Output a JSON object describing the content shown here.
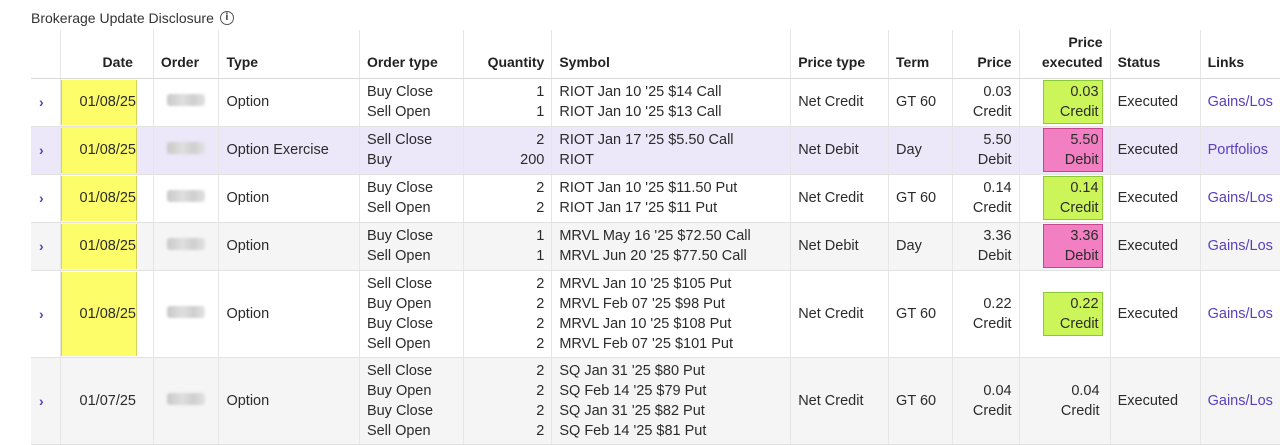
{
  "section": {
    "title": "Brokerage Update Disclosure"
  },
  "headers": {
    "date": "Date",
    "order": "Order",
    "type": "Type",
    "order_type": "Order type",
    "quantity": "Quantity",
    "symbol": "Symbol",
    "price_type": "Price type",
    "term": "Term",
    "price": "Price",
    "price_executed_l1": "Price",
    "price_executed_l2": "executed",
    "status": "Status",
    "links": "Links"
  },
  "colors": {
    "credit_highlight": "#ccf55a",
    "debit_highlight": "#f27fc1",
    "date_highlight": "#fdfd6a",
    "link": "#5a3fc0"
  },
  "rows": [
    {
      "date": "01/08/25",
      "type": "Option",
      "legs": [
        {
          "order_type": "Buy Close",
          "qty": "1",
          "symbol": "RIOT Jan 10 '25 $14 Call"
        },
        {
          "order_type": "Sell Open",
          "qty": "1",
          "symbol": "RIOT Jan 10 '25 $13 Call"
        }
      ],
      "price_type": "Net Credit",
      "term": "GT 60",
      "price": "0.03",
      "price_side": "Credit",
      "executed": "0.03",
      "executed_side": "Credit",
      "status": "Executed",
      "link": "Gains/Los"
    },
    {
      "date": "01/08/25",
      "type": "Option Exercise",
      "legs": [
        {
          "order_type": "Sell Close",
          "qty": "2",
          "symbol": "RIOT Jan 17 '25 $5.50 Call"
        },
        {
          "order_type": "Buy",
          "qty": "200",
          "symbol": "RIOT"
        }
      ],
      "price_type": "Net Debit",
      "term": "Day",
      "price": "5.50",
      "price_side": "Debit",
      "executed": "5.50",
      "executed_side": "Debit",
      "status": "Executed",
      "link": "Portfolios"
    },
    {
      "date": "01/08/25",
      "type": "Option",
      "legs": [
        {
          "order_type": "Buy Close",
          "qty": "2",
          "symbol": "RIOT Jan 10 '25 $11.50 Put"
        },
        {
          "order_type": "Sell Open",
          "qty": "2",
          "symbol": "RIOT Jan 17 '25 $11 Put"
        }
      ],
      "price_type": "Net Credit",
      "term": "GT 60",
      "price": "0.14",
      "price_side": "Credit",
      "executed": "0.14",
      "executed_side": "Credit",
      "status": "Executed",
      "link": "Gains/Los"
    },
    {
      "date": "01/08/25",
      "type": "Option",
      "legs": [
        {
          "order_type": "Buy Close",
          "qty": "1",
          "symbol": "MRVL May 16 '25 $72.50 Call"
        },
        {
          "order_type": "Sell Open",
          "qty": "1",
          "symbol": "MRVL Jun 20 '25 $77.50 Call"
        }
      ],
      "price_type": "Net Debit",
      "term": "Day",
      "price": "3.36",
      "price_side": "Debit",
      "executed": "3.36",
      "executed_side": "Debit",
      "status": "Executed",
      "link": "Gains/Los"
    },
    {
      "date": "01/08/25",
      "type": "Option",
      "legs": [
        {
          "order_type": "Sell Close",
          "qty": "2",
          "symbol": "MRVL Jan 10 '25 $105 Put"
        },
        {
          "order_type": "Buy Open",
          "qty": "2",
          "symbol": "MRVL Feb 07 '25 $98 Put"
        },
        {
          "order_type": "Buy Close",
          "qty": "2",
          "symbol": "MRVL Jan 10 '25 $108 Put"
        },
        {
          "order_type": "Sell Open",
          "qty": "2",
          "symbol": "MRVL Feb 07 '25 $101 Put"
        }
      ],
      "price_type": "Net Credit",
      "term": "GT 60",
      "price": "0.22",
      "price_side": "Credit",
      "executed": "0.22",
      "executed_side": "Credit",
      "status": "Executed",
      "link": "Gains/Los"
    },
    {
      "date": "01/07/25",
      "type": "Option",
      "legs": [
        {
          "order_type": "Sell Close",
          "qty": "2",
          "symbol": "SQ Jan 31 '25 $80 Put"
        },
        {
          "order_type": "Buy Open",
          "qty": "2",
          "symbol": "SQ Feb 14 '25 $79 Put"
        },
        {
          "order_type": "Buy Close",
          "qty": "2",
          "symbol": "SQ Jan 31 '25 $82 Put"
        },
        {
          "order_type": "Sell Open",
          "qty": "2",
          "symbol": "SQ Feb 14 '25 $81 Put"
        }
      ],
      "price_type": "Net Credit",
      "term": "GT 60",
      "price": "0.04",
      "price_side": "Credit",
      "executed": "0.04",
      "executed_side": "Credit",
      "status": "Executed",
      "link": "Gains/Los"
    }
  ]
}
